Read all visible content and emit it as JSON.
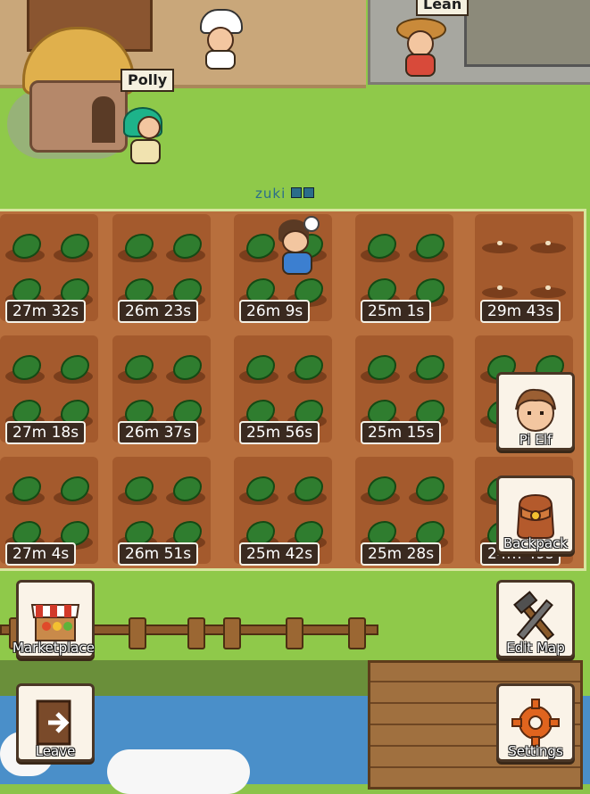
{
  "npcs": {
    "polly": "Polly",
    "lean": "Lean"
  },
  "player": {
    "name": "zuki"
  },
  "plots": [
    {
      "timer": "27m 32s",
      "state": "growing"
    },
    {
      "timer": "26m 23s",
      "state": "growing"
    },
    {
      "timer": "26m 9s",
      "state": "growing"
    },
    {
      "timer": "25m 1s",
      "state": "growing"
    },
    {
      "timer": "29m 43s",
      "state": "seeded"
    },
    {
      "timer": "27m 18s",
      "state": "growing"
    },
    {
      "timer": "26m 37s",
      "state": "growing"
    },
    {
      "timer": "25m 56s",
      "state": "growing"
    },
    {
      "timer": "25m 15s",
      "state": "growing"
    },
    {
      "timer": "",
      "state": "growing"
    },
    {
      "timer": "27m 4s",
      "state": "growing"
    },
    {
      "timer": "26m 51s",
      "state": "growing"
    },
    {
      "timer": "25m 42s",
      "state": "growing"
    },
    {
      "timer": "25m 28s",
      "state": "growing"
    },
    {
      "timer": "24m 49s",
      "state": "growing"
    }
  ],
  "buttons": {
    "pi_elf": "Pi Elf",
    "backpack": "Backpack",
    "marketplace": "Marketplace",
    "edit_map": "Edit Map",
    "leave": "Leave",
    "settings": "Settings"
  },
  "colors": {
    "grass": "#8fc94a",
    "soil": "#b86f3d",
    "button_bg": "#faf3e8",
    "water": "#4a8fc9"
  },
  "icons": {
    "pi_elf": "elf-portrait-icon",
    "backpack": "backpack-icon",
    "marketplace": "market-stall-icon",
    "edit_map": "hammer-wrench-icon",
    "leave": "exit-door-icon",
    "settings": "gear-icon"
  }
}
